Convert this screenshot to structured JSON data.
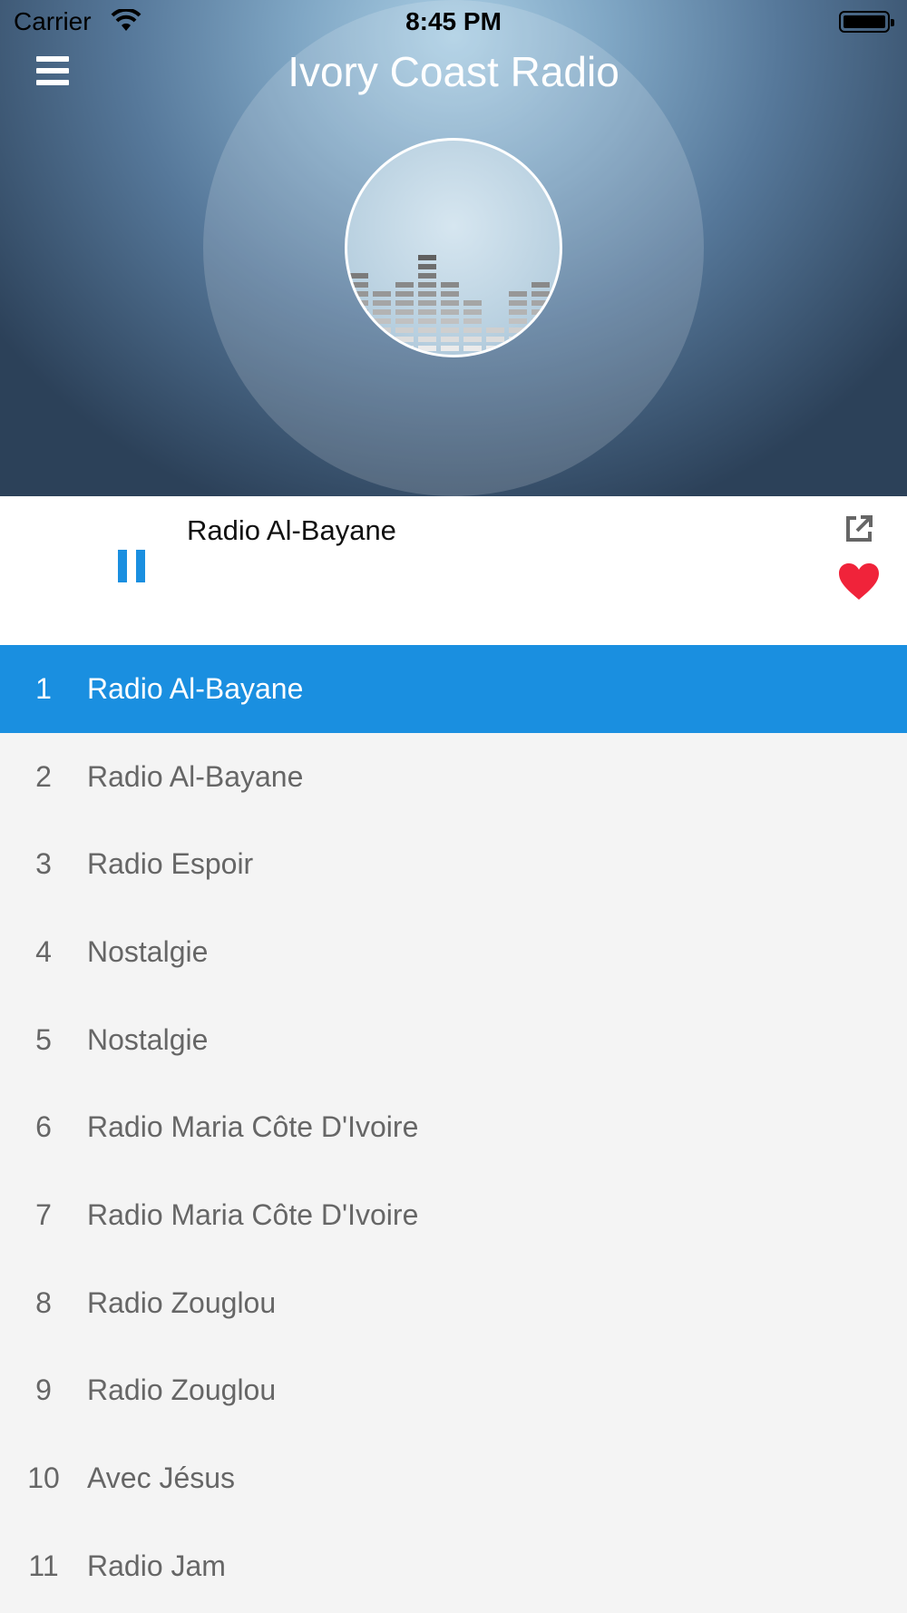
{
  "status_bar": {
    "carrier": "Carrier",
    "time": "8:45 PM"
  },
  "header": {
    "title": "Ivory Coast Radio",
    "menu_icon": "hamburger-menu-icon"
  },
  "now_playing": {
    "station": "Radio Al-Bayane",
    "state_icon": "pause-icon",
    "accent_color": "#1a8fe0",
    "favorite_color": "#f0233a"
  },
  "stations": [
    {
      "num": "1",
      "name": "Radio Al-Bayane",
      "active": true
    },
    {
      "num": "2",
      "name": "Radio Al-Bayane",
      "active": false
    },
    {
      "num": "3",
      "name": "Radio Espoir",
      "active": false
    },
    {
      "num": "4",
      "name": "Nostalgie",
      "active": false
    },
    {
      "num": "5",
      "name": "Nostalgie",
      "active": false
    },
    {
      "num": "6",
      "name": "Radio Maria Côte D'Ivoire",
      "active": false
    },
    {
      "num": "7",
      "name": "Radio Maria Côte D'Ivoire",
      "active": false
    },
    {
      "num": "8",
      "name": "Radio Zouglou",
      "active": false
    },
    {
      "num": "9",
      "name": "Radio Zouglou",
      "active": false
    },
    {
      "num": "10",
      "name": "Avec Jésus",
      "active": false
    },
    {
      "num": "11",
      "name": "Radio Jam",
      "active": false
    }
  ]
}
